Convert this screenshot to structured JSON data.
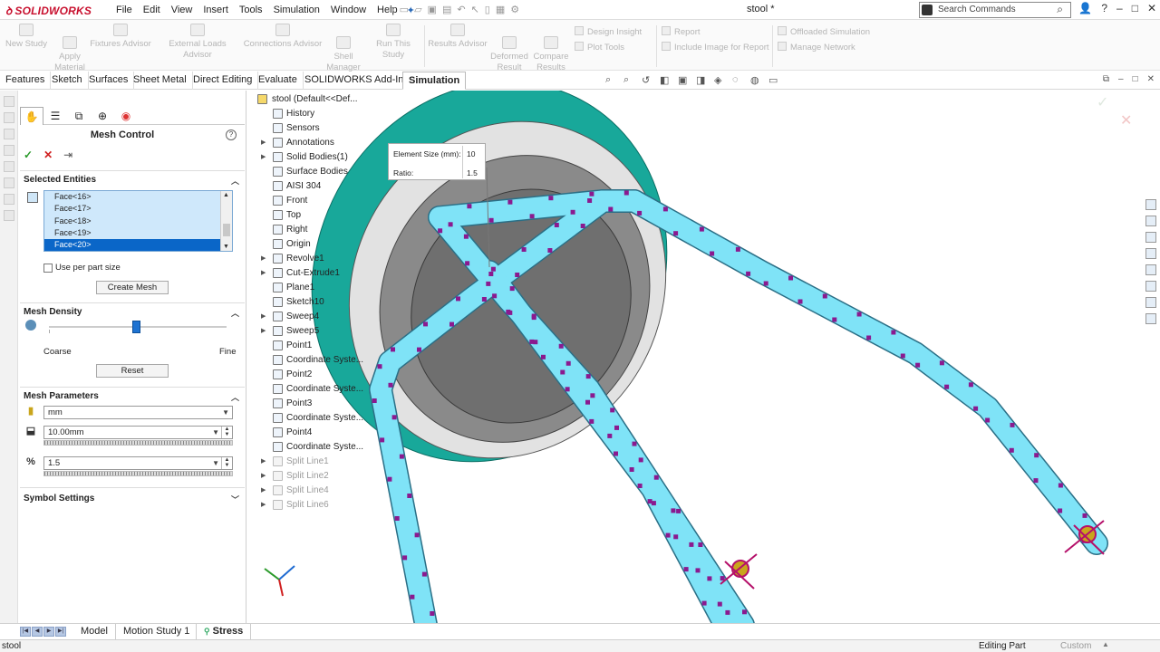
{
  "app": {
    "logo": "SOLIDWORKS",
    "doc_title": "stool *",
    "search_placeholder": "Search Commands"
  },
  "menu": [
    "File",
    "Edit",
    "View",
    "Insert",
    "Tools",
    "Simulation",
    "Window",
    "Help"
  ],
  "command_manager": {
    "new_study": "New Study",
    "apply_material": [
      "Apply",
      "Material"
    ],
    "fixtures_advisor": "Fixtures Advisor",
    "external_loads_advisor": "External Loads Advisor",
    "connections_advisor": "Connections Advisor",
    "shell_manager": [
      "Shell",
      "Manager"
    ],
    "run_this_study": "Run This Study",
    "results_advisor": "Results Advisor",
    "deformed_result": [
      "Deformed",
      "Result"
    ],
    "compare_results": [
      "Compare",
      "Results"
    ],
    "design_insight": "Design Insight",
    "plot_tools": "Plot Tools",
    "report": "Report",
    "include_image_for_report": "Include Image for Report",
    "offloaded_simulation": "Offloaded Simulation",
    "manage_network": "Manage Network"
  },
  "tabs": [
    "Features",
    "Sketch",
    "Surfaces",
    "Sheet Metal",
    "Direct Editing",
    "Evaluate",
    "SOLIDWORKS Add-Ins",
    "Simulation"
  ],
  "property_manager": {
    "title": "Mesh Control",
    "help": "?",
    "selected_entities_header": "Selected Entities",
    "entities": [
      "Face<16>",
      "Face<17>",
      "Face<18>",
      "Face<19>",
      "Face<20>"
    ],
    "selected_entity_index": 4,
    "use_per_part_size": "Use per part size",
    "create_mesh": "Create Mesh",
    "mesh_density_header": "Mesh Density",
    "density_level": 0.49,
    "coarse": "Coarse",
    "fine": "Fine",
    "reset": "Reset",
    "mesh_parameters_header": "Mesh Parameters",
    "unit": "mm",
    "element_size": "10.00mm",
    "ratio": "1.5",
    "symbol_settings_header": "Symbol Settings"
  },
  "tree": {
    "root": "stool  (Default<<Def...",
    "items": [
      {
        "label": "History",
        "icon": "history-icon",
        "exp": false,
        "dim": false
      },
      {
        "label": "Sensors",
        "icon": "sensor-icon",
        "exp": false,
        "dim": false
      },
      {
        "label": "Annotations",
        "icon": "annotation-icon",
        "exp": true,
        "dim": false
      },
      {
        "label": "Solid Bodies(1)",
        "icon": "solid-body-icon",
        "exp": true,
        "dim": false
      },
      {
        "label": "Surface Bodies",
        "icon": "surface-body-icon",
        "exp": false,
        "dim": false
      },
      {
        "label": "AISI 304",
        "icon": "material-icon",
        "exp": false,
        "dim": false
      },
      {
        "label": "Front",
        "icon": "plane-icon",
        "exp": false,
        "dim": false
      },
      {
        "label": "Top",
        "icon": "plane-icon",
        "exp": false,
        "dim": false
      },
      {
        "label": "Right",
        "icon": "plane-icon",
        "exp": false,
        "dim": false
      },
      {
        "label": "Origin",
        "icon": "origin-icon",
        "exp": false,
        "dim": false
      },
      {
        "label": "Revolve1",
        "icon": "revolve-icon",
        "exp": true,
        "dim": false
      },
      {
        "label": "Cut-Extrude1",
        "icon": "cut-extrude-icon",
        "exp": true,
        "dim": false
      },
      {
        "label": "Plane1",
        "icon": "plane-icon",
        "exp": false,
        "dim": false
      },
      {
        "label": "Sketch10",
        "icon": "sketch-icon",
        "exp": false,
        "dim": false
      },
      {
        "label": "Sweep4",
        "icon": "sweep-icon",
        "exp": true,
        "dim": false
      },
      {
        "label": "Sweep5",
        "icon": "sweep-icon",
        "exp": true,
        "dim": false
      },
      {
        "label": "Point1",
        "icon": "point-icon",
        "exp": false,
        "dim": false
      },
      {
        "label": "Coordinate Syste...",
        "icon": "coordinate-system-icon",
        "exp": false,
        "dim": false
      },
      {
        "label": "Point2",
        "icon": "point-icon",
        "exp": false,
        "dim": false
      },
      {
        "label": "Coordinate Syste...",
        "icon": "coordinate-system-icon",
        "exp": false,
        "dim": false
      },
      {
        "label": "Point3",
        "icon": "point-icon",
        "exp": false,
        "dim": false
      },
      {
        "label": "Coordinate Syste...",
        "icon": "coordinate-system-icon",
        "exp": false,
        "dim": false
      },
      {
        "label": "Point4",
        "icon": "point-icon",
        "exp": false,
        "dim": false
      },
      {
        "label": "Coordinate Syste...",
        "icon": "coordinate-system-icon",
        "exp": false,
        "dim": false
      },
      {
        "label": "Split Line1",
        "icon": "split-line-icon",
        "exp": true,
        "dim": true
      },
      {
        "label": "Split Line2",
        "icon": "split-line-icon",
        "exp": true,
        "dim": true
      },
      {
        "label": "Split Line4",
        "icon": "split-line-icon",
        "exp": true,
        "dim": true
      },
      {
        "label": "Split Line6",
        "icon": "split-line-icon",
        "exp": true,
        "dim": true
      }
    ]
  },
  "callout": {
    "element_size_label": "Element Size (mm):",
    "element_size_value": "10",
    "ratio_label": "Ratio:",
    "ratio_value": "1.5"
  },
  "bottom_tabs": [
    "Model",
    "Motion Study 1",
    "Stress"
  ],
  "status": {
    "left": "stool",
    "editing": "Editing Part",
    "units": "Custom"
  },
  "colors": {
    "seat_teal": "#18a89a",
    "tube_cyan": "#7fe3f7",
    "mesh_marker": "#8a1a8f",
    "selection_blue": "#0a66c8"
  }
}
